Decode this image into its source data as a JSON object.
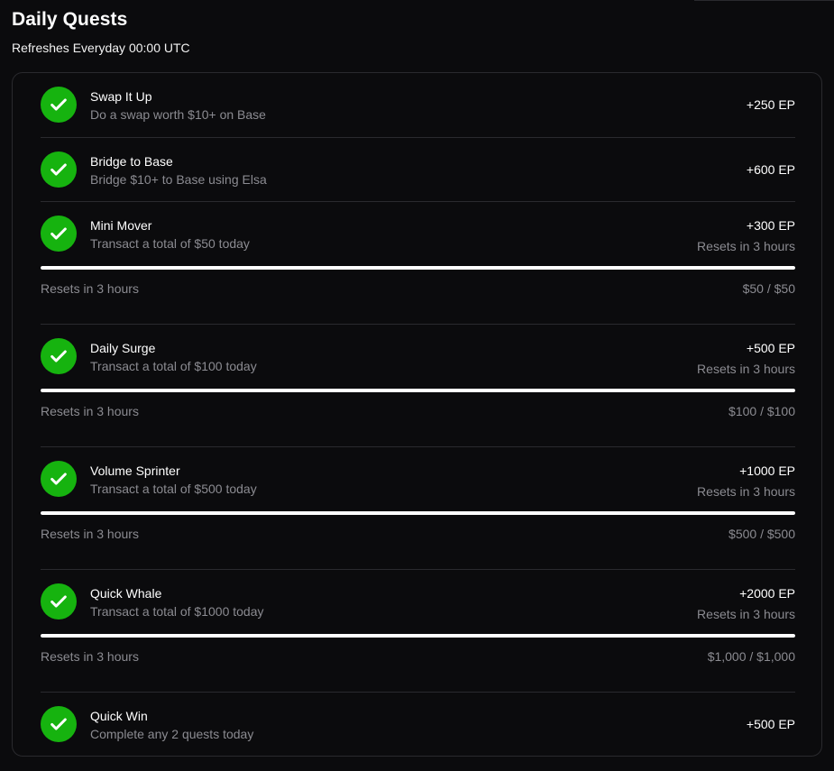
{
  "header": {
    "title": "Daily Quests",
    "subtitle": "Refreshes Everyday 00:00 UTC"
  },
  "colors": {
    "check": "#16b30f",
    "bar_fill": "#ffffff",
    "muted_text": "#8b8b91"
  },
  "quests": [
    {
      "name": "Swap It Up",
      "desc": "Do a swap worth $10+ on Base",
      "reward": "+250 EP",
      "icon": "check-circle-icon"
    },
    {
      "name": "Bridge to Base",
      "desc": "Bridge $10+ to Base using Elsa",
      "reward": "+600 EP",
      "icon": "check-circle-icon"
    },
    {
      "name": "Mini Mover",
      "desc": "Transact a total of $50 today",
      "reward": "+300 EP",
      "reset": "Resets in 3 hours",
      "progress_text": "$50 / $50",
      "progress": 1.0,
      "icon": "check-circle-icon"
    },
    {
      "name": "Daily Surge",
      "desc": "Transact a total of $100 today",
      "reward": "+500 EP",
      "reset": "Resets in 3 hours",
      "progress_text": "$100 / $100",
      "progress": 1.0,
      "icon": "check-circle-icon"
    },
    {
      "name": "Volume Sprinter",
      "desc": "Transact a total of $500 today",
      "reward": "+1000 EP",
      "reset": "Resets in 3 hours",
      "progress_text": "$500 / $500",
      "progress": 1.0,
      "icon": "check-circle-icon"
    },
    {
      "name": "Quick Whale",
      "desc": "Transact a total of $1000 today",
      "reward": "+2000 EP",
      "reset": "Resets in 3 hours",
      "progress_text": "$1,000 / $1,000",
      "progress": 1.0,
      "icon": "check-circle-icon"
    },
    {
      "name": "Quick Win",
      "desc": "Complete any 2 quests today",
      "reward": "+500 EP",
      "icon": "check-circle-icon"
    }
  ]
}
